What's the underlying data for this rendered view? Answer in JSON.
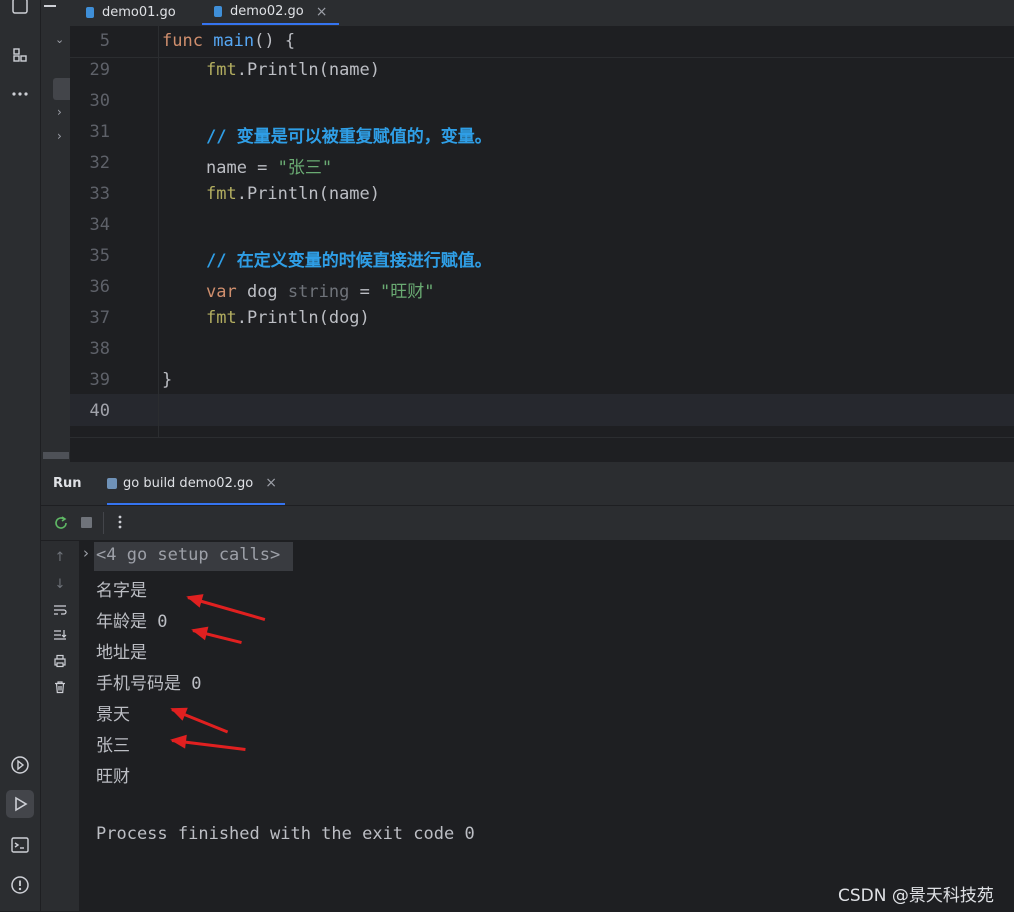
{
  "tabs": [
    {
      "label": "demo01.go",
      "active": false
    },
    {
      "label": "demo02.go",
      "active": true
    }
  ],
  "editor": {
    "sticky": {
      "line": "5",
      "text_kw": "func",
      "text_fn": "main",
      "text_rest": "() {"
    },
    "lines": [
      {
        "n": "29"
      },
      {
        "n": "30"
      },
      {
        "n": "31"
      },
      {
        "n": "32"
      },
      {
        "n": "33"
      },
      {
        "n": "34"
      },
      {
        "n": "35"
      },
      {
        "n": "36"
      },
      {
        "n": "37"
      },
      {
        "n": "38"
      },
      {
        "n": "39"
      },
      {
        "n": "40"
      }
    ],
    "code": {
      "l29_pkg": "fmt",
      "l29_rest": ".Println(name)",
      "l31_cmt": "// 变量是可以被重复赋值的，变量。",
      "l32_a": "name = ",
      "l32_str": "\"张三\"",
      "l33_pkg": "fmt",
      "l33_rest": ".Println(name)",
      "l35_cmt": "// 在定义变量的时候直接进行赋值。",
      "l36_kw": "var",
      "l36_name": " dog ",
      "l36_typ": "string",
      "l36_eq": " = ",
      "l36_str": "\"旺财\"",
      "l37_pkg": "fmt",
      "l37_rest": ".Println(dog)",
      "l39": "}"
    }
  },
  "run": {
    "title": "Run",
    "config_tab": "go build demo02.go",
    "close_glyph": "×",
    "setup_calls": "<4 go setup calls>",
    "output": [
      "名字是",
      "年龄是 0",
      "地址是",
      "手机号码是 0",
      "景天",
      "张三",
      "旺财",
      "",
      "Process finished with the exit code 0"
    ]
  },
  "watermark": "CSDN @景天科技苑",
  "colors": {
    "accent": "#3574f0",
    "arrow": "#e02020",
    "comment": "#2f9ee6",
    "string": "#6aab73",
    "keyword": "#cf8e6d"
  }
}
